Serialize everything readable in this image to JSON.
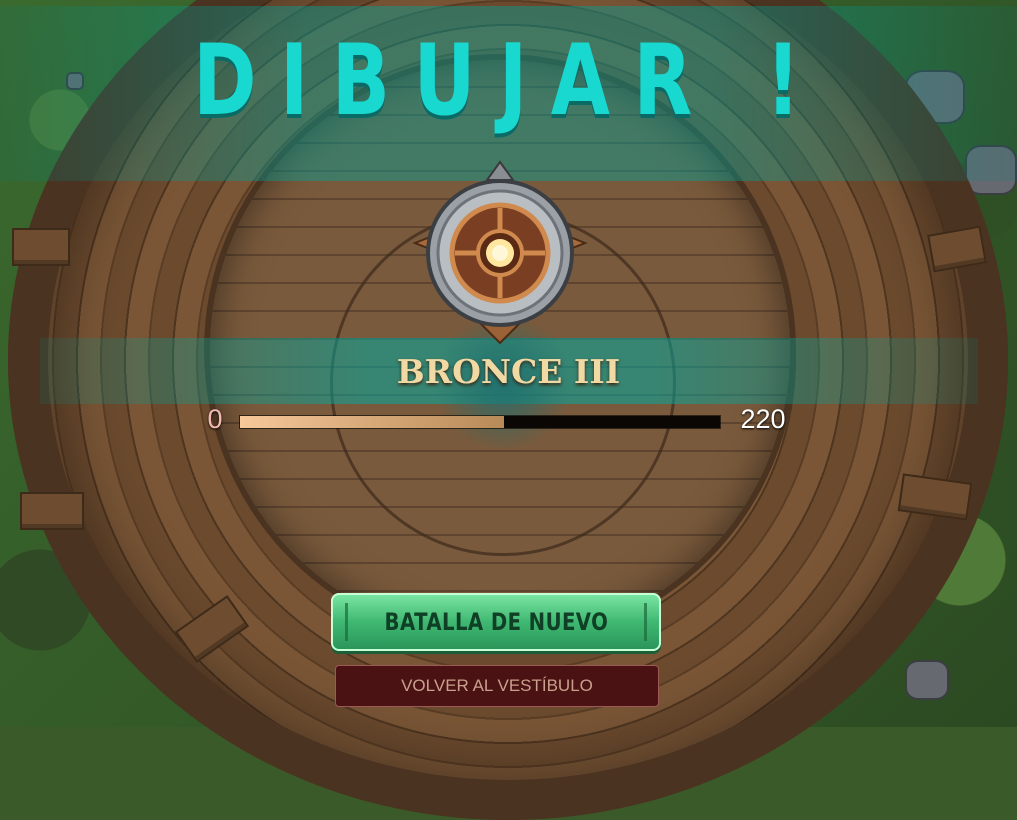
{
  "result": {
    "title": "DIBUJAR !"
  },
  "rank": {
    "name": "BRONCE III",
    "badge_icon": "bronze-rank-badge-icon"
  },
  "progress": {
    "min_label": "0",
    "max_label": "220",
    "fraction": 0.55
  },
  "buttons": {
    "battle_again": "BATALLA DE NUEVO",
    "back_to_lobby": "VOLVER AL VESTÍBULO"
  },
  "colors": {
    "title": "#18d8d0",
    "primary_button": "#3fb872",
    "secondary_button": "#4a1212",
    "rank_text": "#f1d9a4"
  }
}
